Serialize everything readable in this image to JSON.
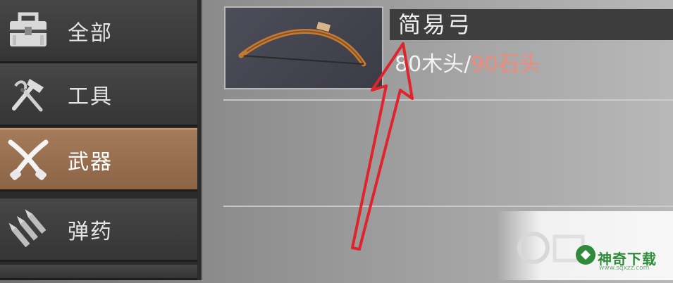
{
  "sidebar": {
    "items": [
      {
        "label": "全部",
        "icon": "toolbox-icon",
        "active": false
      },
      {
        "label": "工具",
        "icon": "pliers-hammer-icon",
        "active": false
      },
      {
        "label": "武器",
        "icon": "crossed-blades-icon",
        "active": true
      },
      {
        "label": "弹药",
        "icon": "bullets-icon",
        "active": false
      }
    ]
  },
  "item": {
    "name": "简易弓",
    "cost_wood": "80木头",
    "cost_separator": "/",
    "cost_stone": "90石头"
  },
  "watermark": {
    "brand": "神奇下载",
    "url": "www.sqxzz.com"
  },
  "colors": {
    "active_category": "#9a7252",
    "cost_insufficient": "#f08a7a",
    "annotation_arrow": "#e0242c"
  }
}
